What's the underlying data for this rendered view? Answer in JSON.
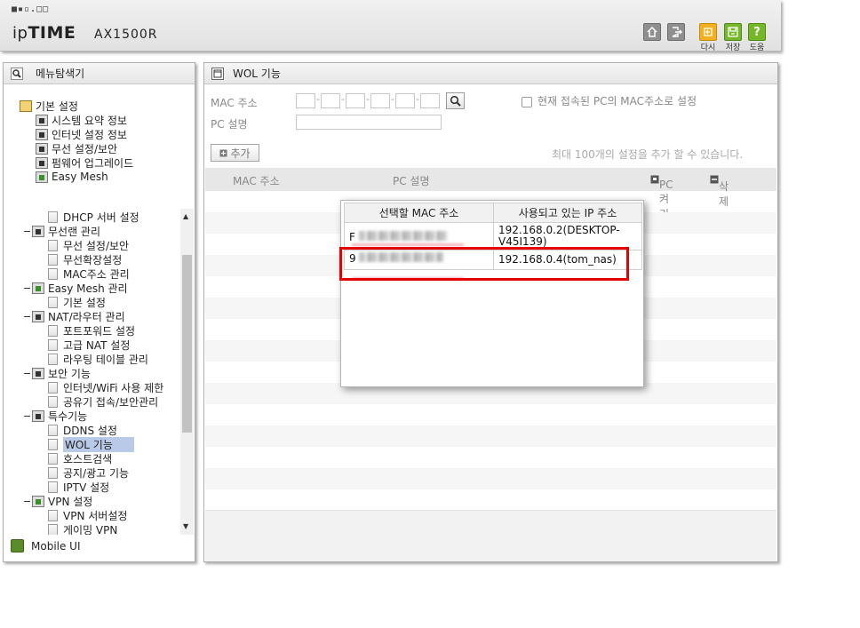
{
  "header": {
    "top_logo": "■▪▫.□□",
    "brand_light": "ip",
    "brand_bold": "TIME",
    "model": "AX1500R",
    "buttons": [
      {
        "name": "home-button",
        "label": ""
      },
      {
        "name": "logout-button",
        "label": ""
      },
      {
        "name": "reload-button",
        "label": "다시"
      },
      {
        "name": "save-button",
        "label": "저장"
      },
      {
        "name": "help-button",
        "label": "도움"
      }
    ],
    "colors": {
      "reload": "#f0b020",
      "save": "#76b72a",
      "help": "#76b72a"
    }
  },
  "sidebar": {
    "title": "메뉴탐색기",
    "top_items": [
      {
        "label": "기본 설정",
        "icon": "folder-icon",
        "level": 0
      },
      {
        "label": "시스템 요약 정보",
        "icon": "chart-icon",
        "level": 1
      },
      {
        "label": "인터넷 설정 정보",
        "icon": "monitor-icon",
        "level": 1
      },
      {
        "label": "무선 설정/보안",
        "icon": "wifi-icon",
        "level": 1
      },
      {
        "label": "펌웨어 업그레이드",
        "icon": "upgrade-icon",
        "level": 1
      },
      {
        "label": "Easy Mesh",
        "icon": "mesh-icon",
        "level": 1
      }
    ],
    "scroll_items": [
      {
        "label": "DHCP 서버 설정",
        "type": "page"
      },
      {
        "label": "무선랜 관리",
        "type": "group"
      },
      {
        "label": "무선 설정/보안",
        "type": "page"
      },
      {
        "label": "무선확장설정",
        "type": "page"
      },
      {
        "label": "MAC주소 관리",
        "type": "page"
      },
      {
        "label": "Easy Mesh 관리",
        "type": "group"
      },
      {
        "label": "기본 설정",
        "type": "page"
      },
      {
        "label": "NAT/라우터 관리",
        "type": "group"
      },
      {
        "label": "포트포워드 설정",
        "type": "page"
      },
      {
        "label": "고급 NAT 설정",
        "type": "page"
      },
      {
        "label": "라우팅 테이블 관리",
        "type": "page"
      },
      {
        "label": "보안 기능",
        "type": "group"
      },
      {
        "label": "인터넷/WiFi 사용 제한",
        "type": "page"
      },
      {
        "label": "공유기 접속/보안관리",
        "type": "page"
      },
      {
        "label": "특수기능",
        "type": "group"
      },
      {
        "label": "DDNS 설정",
        "type": "page"
      },
      {
        "label": "WOL 기능",
        "type": "page",
        "selected": true
      },
      {
        "label": "호스트검색",
        "type": "page"
      },
      {
        "label": "공지/광고 기능",
        "type": "page"
      },
      {
        "label": "IPTV 설정",
        "type": "page"
      },
      {
        "label": "VPN 설정",
        "type": "group"
      },
      {
        "label": "VPN 서버설정",
        "type": "page"
      },
      {
        "label": "게이밍 VPN",
        "type": "page"
      }
    ],
    "mobile_label": "Mobile UI"
  },
  "main": {
    "title": "WOL 기능",
    "mac_label": "MAC 주소",
    "pc_label": "PC 설명",
    "checkbox_label": "현재 접속된 PC의 MAC주소로 설정",
    "add_button": "추가",
    "hint": "최대 100개의 설정을 추가 할 수 있습니다.",
    "table_headers": {
      "mac": "MAC 주소",
      "pc": "PC 설명",
      "wake": "PC 켜기",
      "delete": "삭제"
    }
  },
  "popup": {
    "headers": [
      "선택할 MAC 주소",
      "사용되고 있는 IP 주소"
    ],
    "rows": [
      {
        "mac_prefix": "F",
        "ip": "192.168.0.2(DESKTOP-V45I139)"
      },
      {
        "mac_prefix": "9",
        "ip": "192.168.0.4(tom_nas)"
      }
    ],
    "highlight_color": "#e60000"
  }
}
